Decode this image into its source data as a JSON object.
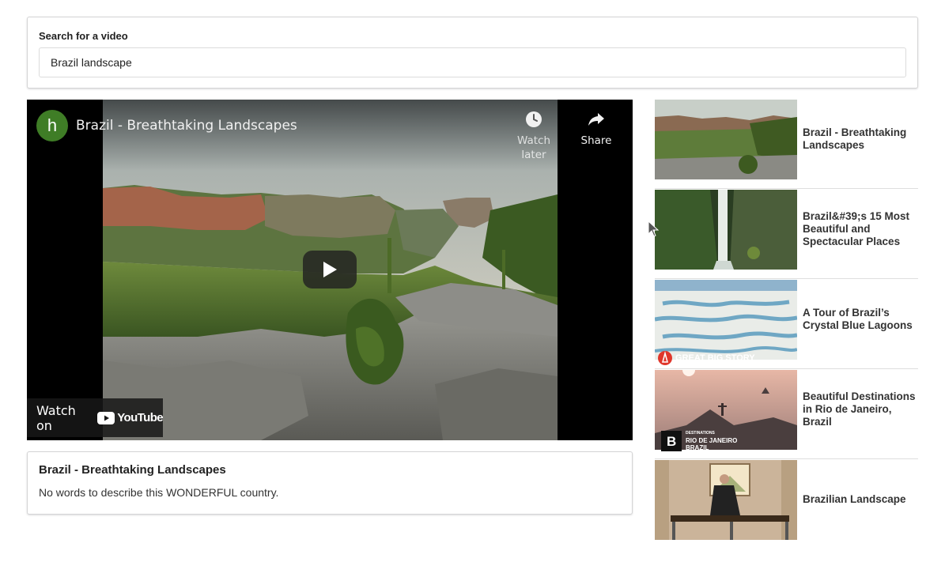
{
  "search": {
    "label": "Search for a video",
    "value": "Brazil landscape"
  },
  "player": {
    "channel_initial": "h",
    "title": "Brazil - Breathtaking Landscapes",
    "watch_later_label": "Watch later",
    "share_label": "Share",
    "watch_on_label": "Watch on",
    "youtube_label": "YouTube"
  },
  "description": {
    "title": "Brazil - Breathtaking Landscapes",
    "text": "No words to describe this WONDERFUL country."
  },
  "videos": [
    {
      "title": "Brazil - Breathtaking Landscapes"
    },
    {
      "title": "Brazil&#39;s 15 Most Beautiful and Spectacular Places"
    },
    {
      "title": "A Tour of Brazil’s Crystal Blue Lagoons",
      "badge": "GREAT BIG STORY"
    },
    {
      "title": "Beautiful Destinations in Rio de Janeiro, Brazil",
      "badge_line1": "DESTINATIONS",
      "badge_line2": "RIO DE JANEIRO",
      "badge_line3": "BRAZIL"
    },
    {
      "title": "Brazilian Landscape"
    }
  ],
  "colors": {
    "avatar": "#3f7d26",
    "youtube_red": "#ff0000",
    "border": "#d4d4d5"
  }
}
